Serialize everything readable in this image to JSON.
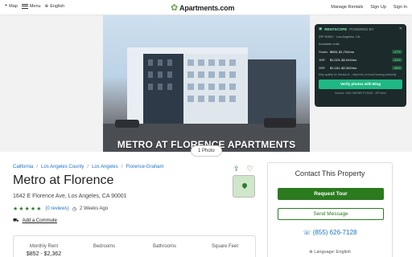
{
  "header": {
    "map_label": "Map",
    "menu_label": "Menu",
    "language_label": "English",
    "logo_text": "Apartments.com",
    "links": [
      "Manage Rentals",
      "Sign Up",
      "Sign In"
    ]
  },
  "hero": {
    "caption": "METRO AT FLORENCE APARTMENTS",
    "photo_count_label": "1 Photo"
  },
  "rentscope": {
    "brand": "RENTSCOPE",
    "brand_sub": "POWERED BY",
    "zip_line": "ZIP 90001 · Los Angeles, CA",
    "available_units": "Available units",
    "rows": [
      {
        "unit": "Studio",
        "range": "$853–$1,704/mo",
        "pct": "-47%"
      },
      {
        "unit": "1BR",
        "range": "$1,023–$2,044/mo",
        "pct": "-44%"
      },
      {
        "unit": "2BR",
        "range": "$1,181–$2,362/mo",
        "pct": "-48%"
      }
    ],
    "note": "May qualify for Section 8 – depends on local housing authority",
    "button": "Verify photos with Bing",
    "footer": "Source: HUD SAFMR FY2025 · ZIP level"
  },
  "listing": {
    "breadcrumbs": [
      "California",
      "Los Angeles County",
      "Los Angeles",
      "Florence-Graham"
    ],
    "title": "Metro at Florence",
    "address": "1642 E Florence Ave, Los Angeles, CA 90001",
    "stars": "★★★★★",
    "reviews": "(0 reviews)",
    "updated": "2 Weeks Ago",
    "commute": "Add a Commute"
  },
  "stats": [
    {
      "label": "Monthly Rent",
      "value": "$852 - $2,362"
    },
    {
      "label": "Bedrooms",
      "value": ""
    },
    {
      "label": "Bathrooms",
      "value": ""
    },
    {
      "label": "Square Feet",
      "value": ""
    }
  ],
  "contact": {
    "title": "Contact This Property",
    "tour_button": "Request Tour",
    "message_button": "Send Message",
    "phone": "(855) 626-7128",
    "language": "Language: English"
  },
  "colors": {
    "brand_green": "#2b7a1e",
    "link_blue": "#1a73c8",
    "rentscope_bg": "#1d2a2b",
    "rentscope_accent": "#1fb882"
  }
}
